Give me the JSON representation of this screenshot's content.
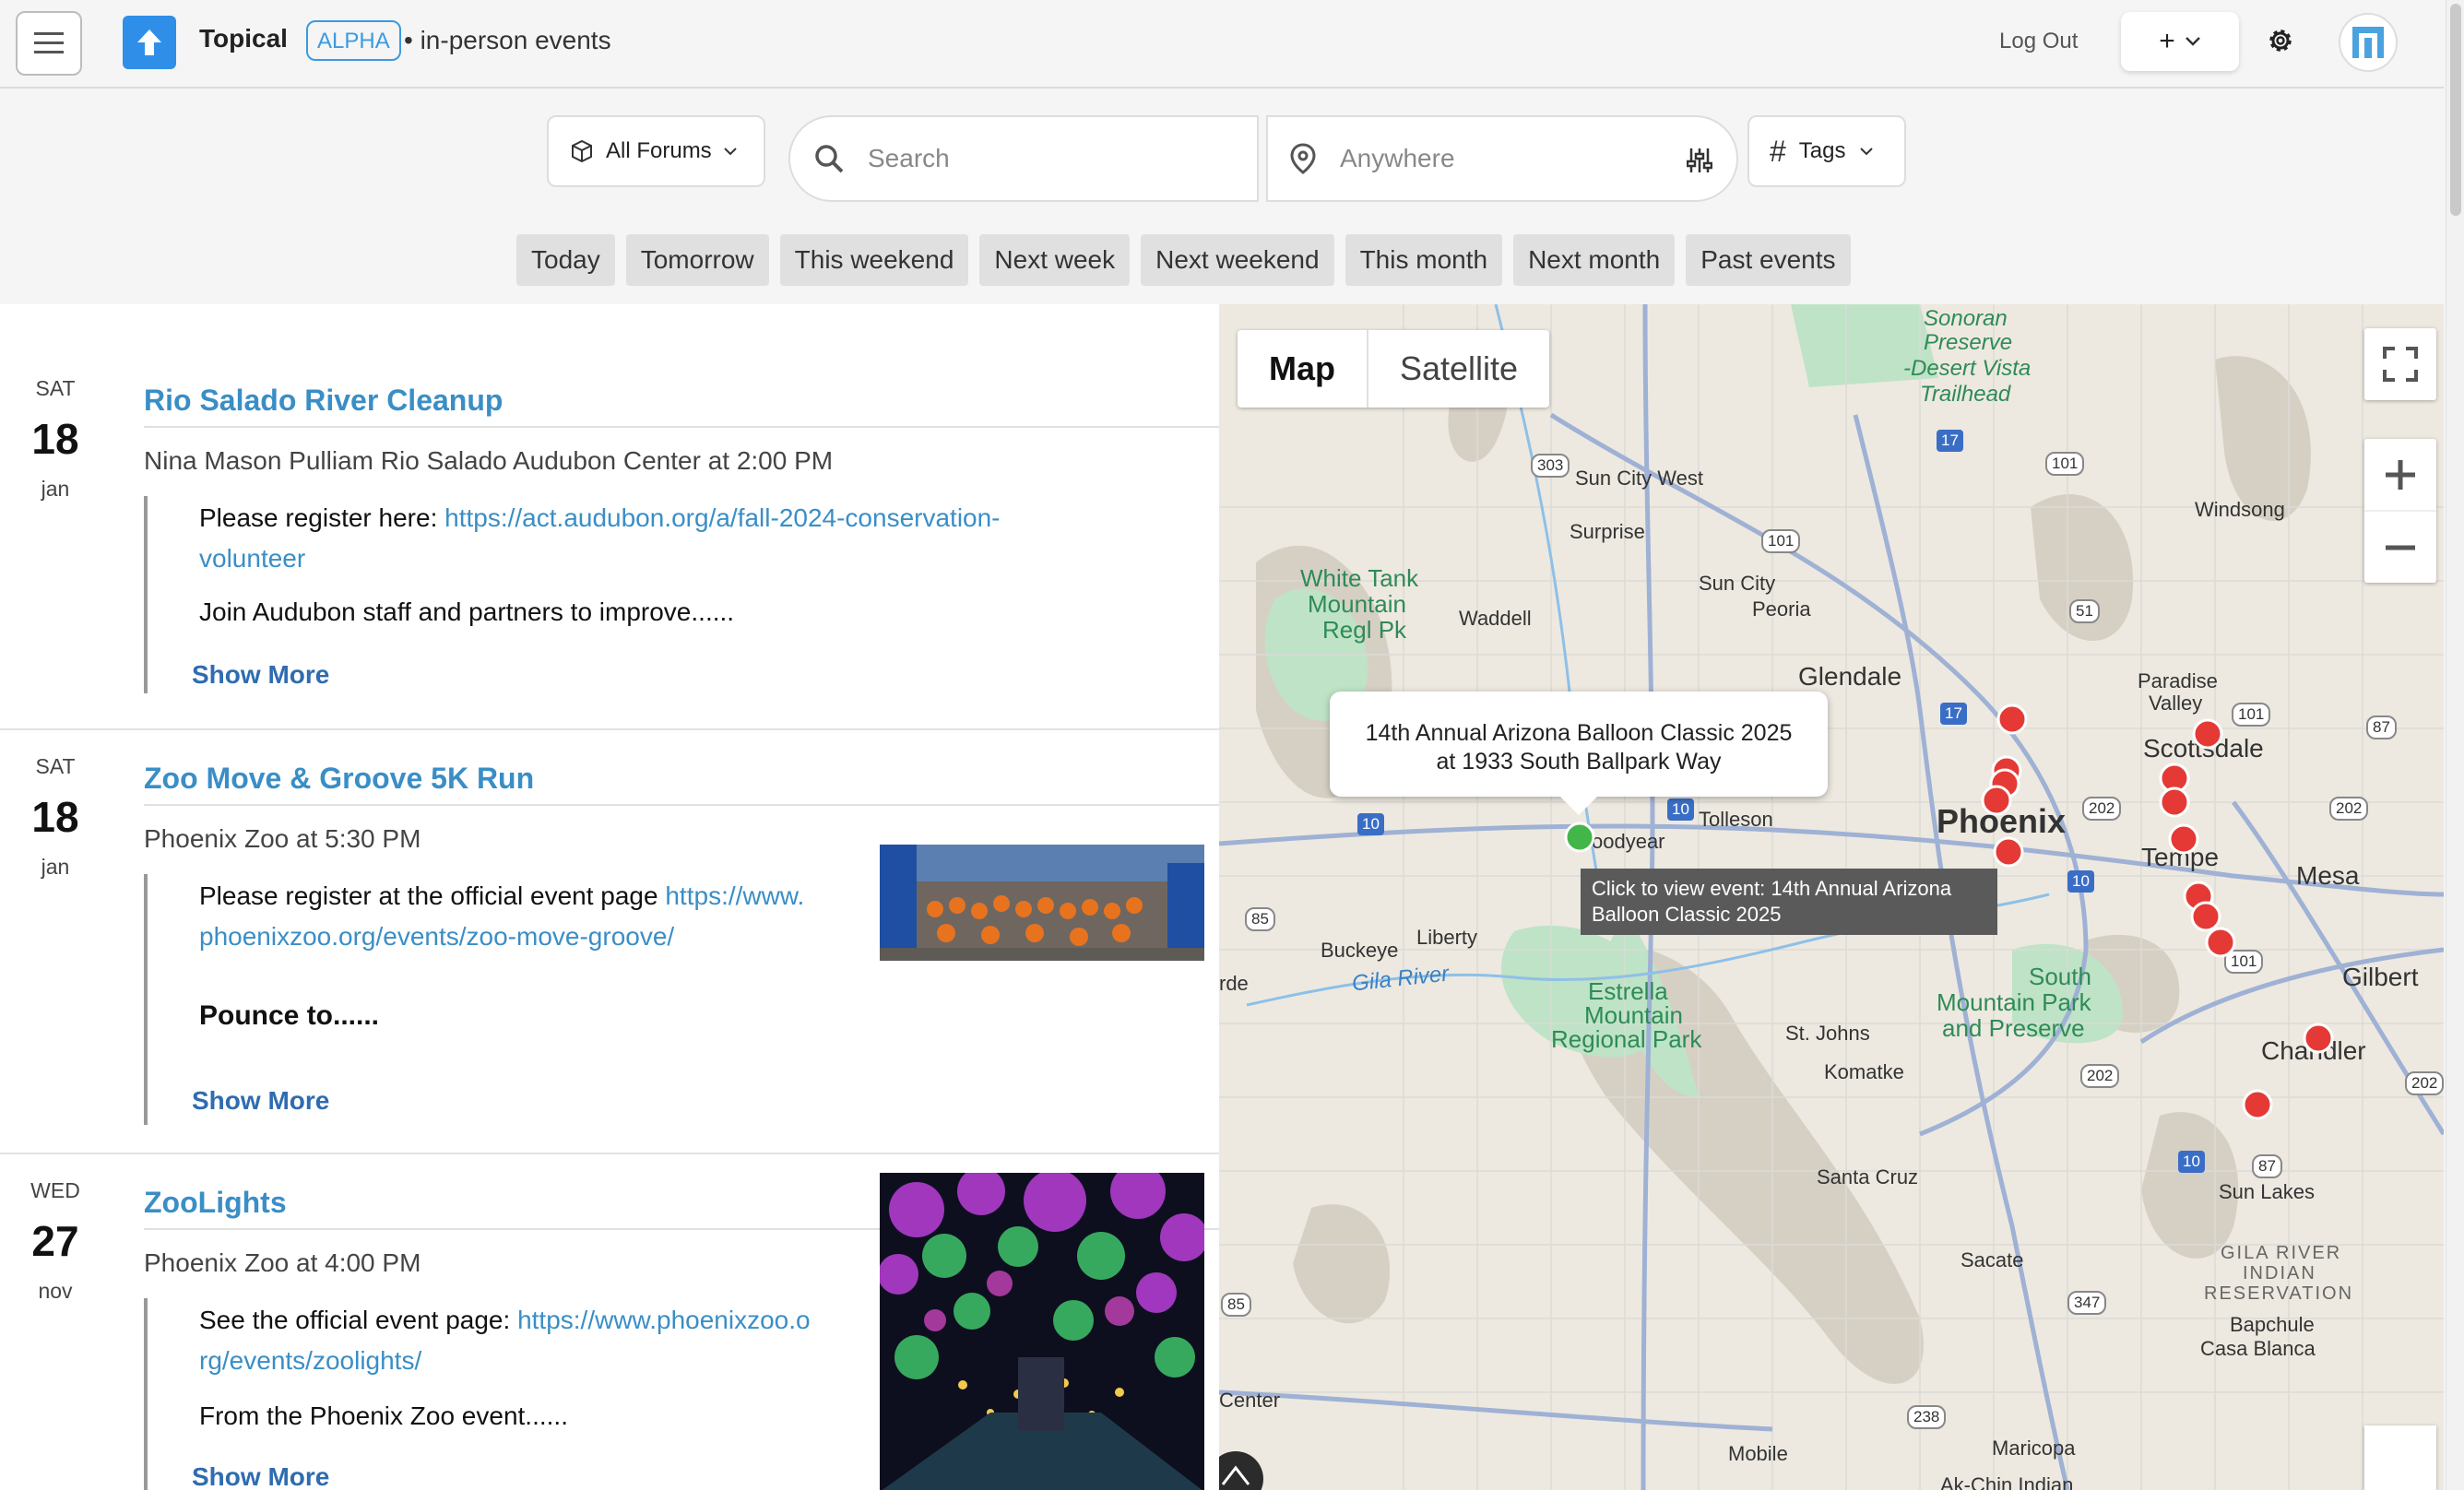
{
  "header": {
    "app_name": "Topical",
    "badge": "ALPHA",
    "subtitle": "• in-person events",
    "logout": "Log Out",
    "add_label": "+"
  },
  "filters": {
    "forums_label": "All Forums",
    "search_placeholder": "Search",
    "location_placeholder": "Anywhere",
    "tags_label": "Tags",
    "date_chips": [
      "Today",
      "Tomorrow",
      "This weekend",
      "Next week",
      "Next weekend",
      "This month",
      "Next month",
      "Past events"
    ]
  },
  "events": [
    {
      "dow": "SAT",
      "day": "18",
      "month": "jan",
      "title": "Rio Salado River Cleanup",
      "location": "Nina Mason Pulliam Rio Salado Audubon Center at 2:00 PM",
      "desc_prefix": "Please register here: ",
      "link_line1": "https://act.audubon.org/a/fall-2024-conservation-",
      "link_line2": "volunteer",
      "body": "Join Audubon staff and partners to improve......",
      "show_more": "Show More"
    },
    {
      "dow": "SAT",
      "day": "18",
      "month": "jan",
      "title": "Zoo Move & Groove 5K Run",
      "location": "Phoenix Zoo at 5:30 PM",
      "desc_prefix": "Please register at the official event page ",
      "link_line1": "https://www.",
      "link_line2": "phoenixzoo.org/events/zoo-move-groove/",
      "body": "Pounce to......",
      "show_more": "Show More"
    },
    {
      "dow": "WED",
      "day": "27",
      "month": "nov",
      "title": "ZooLights",
      "location": "Phoenix Zoo at 4:00 PM",
      "desc_prefix": "See the official event page: ",
      "link_line1": "https://www.phoenixzoo.o",
      "link_line2": "rg/events/zoolights/",
      "body": "From the Phoenix Zoo event......",
      "show_more": "Show More"
    }
  ],
  "map": {
    "type_map": "Map",
    "type_satellite": "Satellite",
    "infowindow_title": "14th Annual Arizona Balloon Classic 2025",
    "infowindow_sub": "at 1933 South Ballpark Way",
    "tooltip": "Click to view event: 14th Annual Arizona Balloon Classic 2025",
    "labels": {
      "sonoran": "Sonoran",
      "preserve": "Preserve",
      "desert_vista": "-Desert Vista",
      "trailhead": "Trailhead",
      "sun_city_west": "Sun City West",
      "surprise": "Surprise",
      "sun_city": "Sun City",
      "peoria": "Peoria",
      "windsong": "Windsong",
      "white_tank": "White Tank",
      "mountain": "Mountain",
      "regl_pk": "Regl Pk",
      "waddell": "Waddell",
      "glendale": "Glendale",
      "paradise": "Paradise",
      "valley": "Valley",
      "scottsdale": "Scottsdale",
      "tolleson": "Tolleson",
      "goodyear": "oodyear",
      "phoenix": "Phoenix",
      "tempe": "Tempe",
      "mesa": "Mesa",
      "buckeye": "Buckeye",
      "liberty": "Liberty",
      "gila_river": "Gila River",
      "estrella": "Estrella",
      "estrella_mountain": "Mountain",
      "regional_park": "Regional Park",
      "south": "South",
      "south_mountain_park": "Mountain Park",
      "and_preserve": "and Preserve",
      "st_johns": "St. Johns",
      "komatke": "Komatke",
      "gilbert": "Gilbert",
      "chandler": "Chandler",
      "santa_cruz": "Santa Cruz",
      "sun_lakes": "Sun Lakes",
      "sacate": "Sacate",
      "gila_river_indian": "GILA RIVER",
      "indian": "INDIAN",
      "reservation": "RESERVATION",
      "bapchule": "Bapchule",
      "casa_blanca": "Casa Blanca",
      "mobile": "Mobile",
      "maricopa": "Maricopa",
      "center": "Center",
      "rde": "rde",
      "ak_chin": "Ak-Chin Indian"
    },
    "shields": [
      "303",
      "17",
      "101",
      "101",
      "51",
      "17",
      "101",
      "87",
      "10",
      "10",
      "202",
      "202",
      "10",
      "85",
      "101",
      "202",
      "202",
      "10",
      "87",
      "85",
      "347",
      "238"
    ]
  },
  "colors": {
    "accent": "#3a8ec6",
    "logo_blue": "#2f8fe8",
    "event_pin": "#e53935",
    "selected_pin": "#43b649"
  }
}
